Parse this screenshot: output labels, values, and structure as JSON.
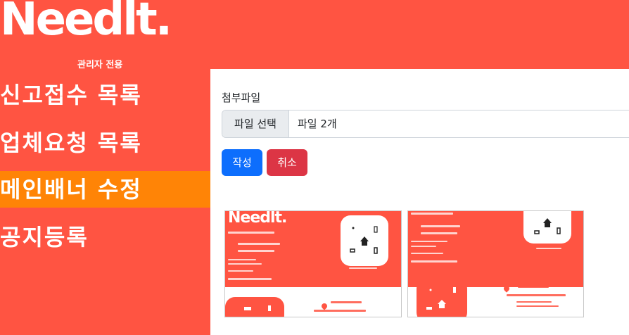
{
  "header": {
    "logo_text": "Needlt.",
    "logo_subtitle": "관리자 전용",
    "brand_color": "#FF5442"
  },
  "sidebar": {
    "items": [
      {
        "label": "신고접수 목록",
        "active": false
      },
      {
        "label": "업체요청 목록",
        "active": false
      },
      {
        "label": "메인배너 수정",
        "active": true
      },
      {
        "label": "공지등록",
        "active": false
      }
    ],
    "active_color": "#FF8406"
  },
  "form": {
    "attachment_label": "첨부파일",
    "file_button_label": "파일 선택",
    "file_status": "파일 2개",
    "submit_label": "작성",
    "cancel_label": "취소",
    "submit_color": "#0D6EFD",
    "cancel_color": "#DC3545"
  },
  "banners": [
    {
      "logo": "Needlt."
    },
    {
      "logo": ""
    }
  ]
}
